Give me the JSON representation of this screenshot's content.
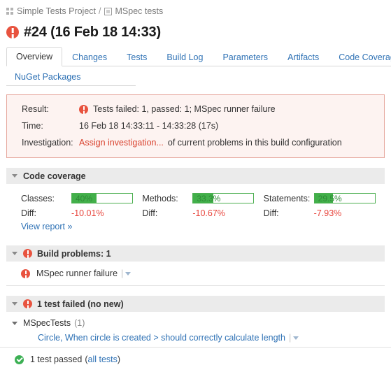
{
  "breadcrumb": {
    "project_icon": "grid-icon",
    "project": "Simple Tests Project",
    "separator": "/",
    "config_icon": "square-icon",
    "config": "MSpec tests"
  },
  "header": {
    "status_icon": "error-icon",
    "title": "#24 (16 Feb 18 14:33)"
  },
  "tabs": {
    "row1": [
      {
        "label": "Overview",
        "active": true
      },
      {
        "label": "Changes",
        "active": false
      },
      {
        "label": "Tests",
        "active": false
      },
      {
        "label": "Build Log",
        "active": false
      },
      {
        "label": "Parameters",
        "active": false
      },
      {
        "label": "Artifacts",
        "active": false
      },
      {
        "label": "Code Coverage",
        "active": false
      }
    ],
    "row2": [
      {
        "label": "NuGet Packages",
        "active": false
      }
    ]
  },
  "result_box": {
    "rows": [
      {
        "label": "Result:",
        "icon": "error-icon",
        "value": "Tests failed: 1, passed: 1; MSpec runner failure"
      },
      {
        "label": "Time:",
        "value": "16 Feb 18 14:33:11 - 14:33:28 (17s)"
      },
      {
        "label": "Investigation:",
        "link": "Assign investigation...",
        "tail": "of current problems in this build configuration"
      }
    ]
  },
  "coverage": {
    "section_title": "Code coverage",
    "metrics": [
      {
        "name": "Classes:",
        "value": "40%",
        "percent": 40,
        "diff_label": "Diff:",
        "diff_value": "-10.01%"
      },
      {
        "name": "Methods:",
        "value": "33.3%",
        "percent": 33.3,
        "diff_label": "Diff:",
        "diff_value": "-10.67%"
      },
      {
        "name": "Statements:",
        "value": "29.5%",
        "percent": 29.5,
        "diff_label": "Diff:",
        "diff_value": "-7.93%"
      }
    ],
    "view_report": "View report »"
  },
  "build_problems": {
    "section_title": "Build problems: 1",
    "items": [
      {
        "icon": "error-icon",
        "text": "MSpec runner failure"
      }
    ]
  },
  "tests": {
    "section_title": "1 test failed (no new)",
    "suite": {
      "name": "MSpecTests",
      "count": "(1)",
      "cases": [
        {
          "name": "Circle, When circle is created > should correctly calculate length"
        }
      ]
    },
    "passed": {
      "icon": "success-icon",
      "text": "1 test passed",
      "open_paren": "(",
      "link": "all tests",
      "close_paren": ")"
    }
  },
  "colors": {
    "error": "#e8533f",
    "success": "#3cb054",
    "link": "#2f72b5",
    "danger_text": "#e8453c",
    "coverage_fill": "#42b04a",
    "section_bg": "#ebebeb",
    "result_bg": "#fdf3f1",
    "result_border": "#e6a79d"
  }
}
